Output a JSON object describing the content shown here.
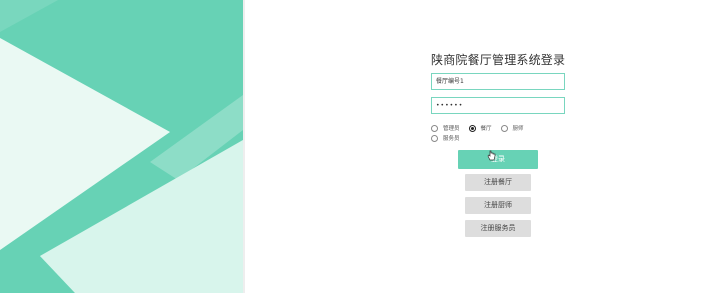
{
  "login": {
    "title": "陕商院餐厅管理系统登录",
    "username_value": "餐厅编号1",
    "password_value": "••••••"
  },
  "roles": [
    {
      "label": "管理员",
      "checked": false
    },
    {
      "label": "餐厅",
      "checked": true
    },
    {
      "label": "厨师",
      "checked": false
    },
    {
      "label": "服务员",
      "checked": false
    }
  ],
  "buttons": {
    "login": "登录",
    "register_restaurant": "注册餐厅",
    "register_chef": "注册厨师",
    "register_waiter": "注册服务员"
  },
  "colors": {
    "accent": "#67d2b5",
    "secondary_button": "#dddddd"
  }
}
